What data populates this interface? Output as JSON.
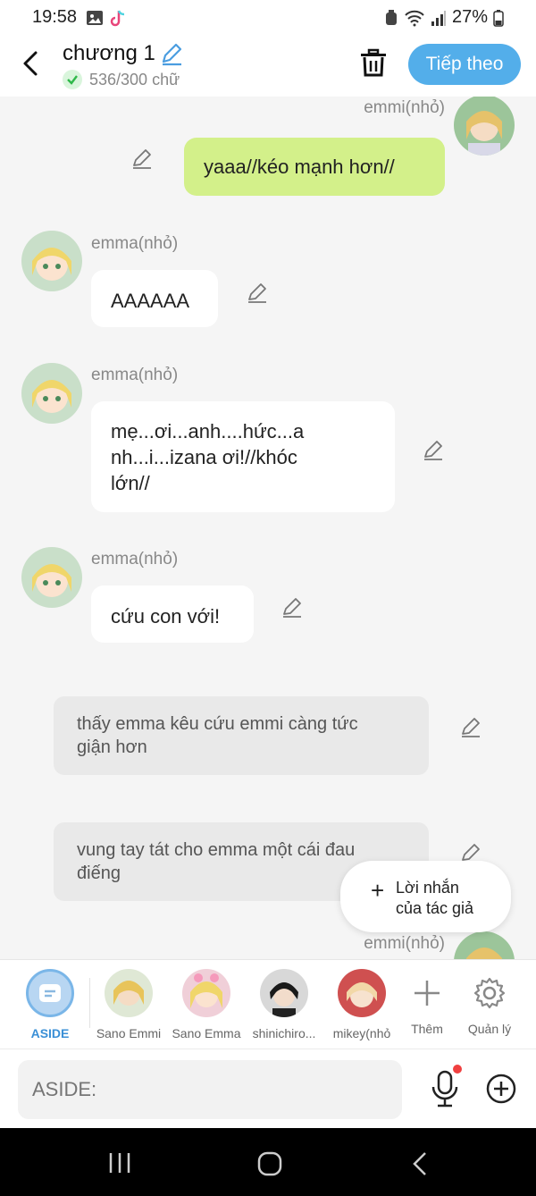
{
  "status_bar": {
    "time": "19:58",
    "battery": "27%"
  },
  "header": {
    "title": "chương 1",
    "word_count": "536/300 chữ",
    "next_label": "Tiếp theo"
  },
  "messages": [
    {
      "speaker": "emmi(nhỏ)",
      "text": "yaaa//kéo mạnh hơn//"
    },
    {
      "speaker": "emma(nhỏ)",
      "text": "AAAAAA"
    },
    {
      "speaker": "emma(nhỏ)",
      "text_lines": [
        "mẹ...ơi...anh....hức...a",
        "nh...i...izana ơi!//khóc",
        "lớn//"
      ]
    },
    {
      "speaker": "emma(nhỏ)",
      "text": "cứu con với!"
    },
    {
      "narration_lines": [
        "thấy emma kêu cứu emmi càng tức",
        "giận hơn"
      ]
    },
    {
      "narration_lines": [
        "vung tay tát cho emma một cái đau",
        "điếng"
      ]
    },
    {
      "speaker": "emmi(nhỏ)"
    }
  ],
  "author_note": {
    "line1": "Lời nhắn",
    "line2": "của tác giả"
  },
  "characters": [
    {
      "label": "ASIDE"
    },
    {
      "label": "Sano Emmi"
    },
    {
      "label": "Sano Emma"
    },
    {
      "label": "shinichiro..."
    },
    {
      "label": "mikey(nhỏ"
    },
    {
      "label": "Thêm"
    },
    {
      "label": "Quản lý"
    }
  ],
  "input": {
    "placeholder": "ASIDE:"
  },
  "colors": {
    "accent": "#53aeea",
    "user_bubble": "#d3f08a",
    "narration_bg": "#e9e9e9"
  }
}
